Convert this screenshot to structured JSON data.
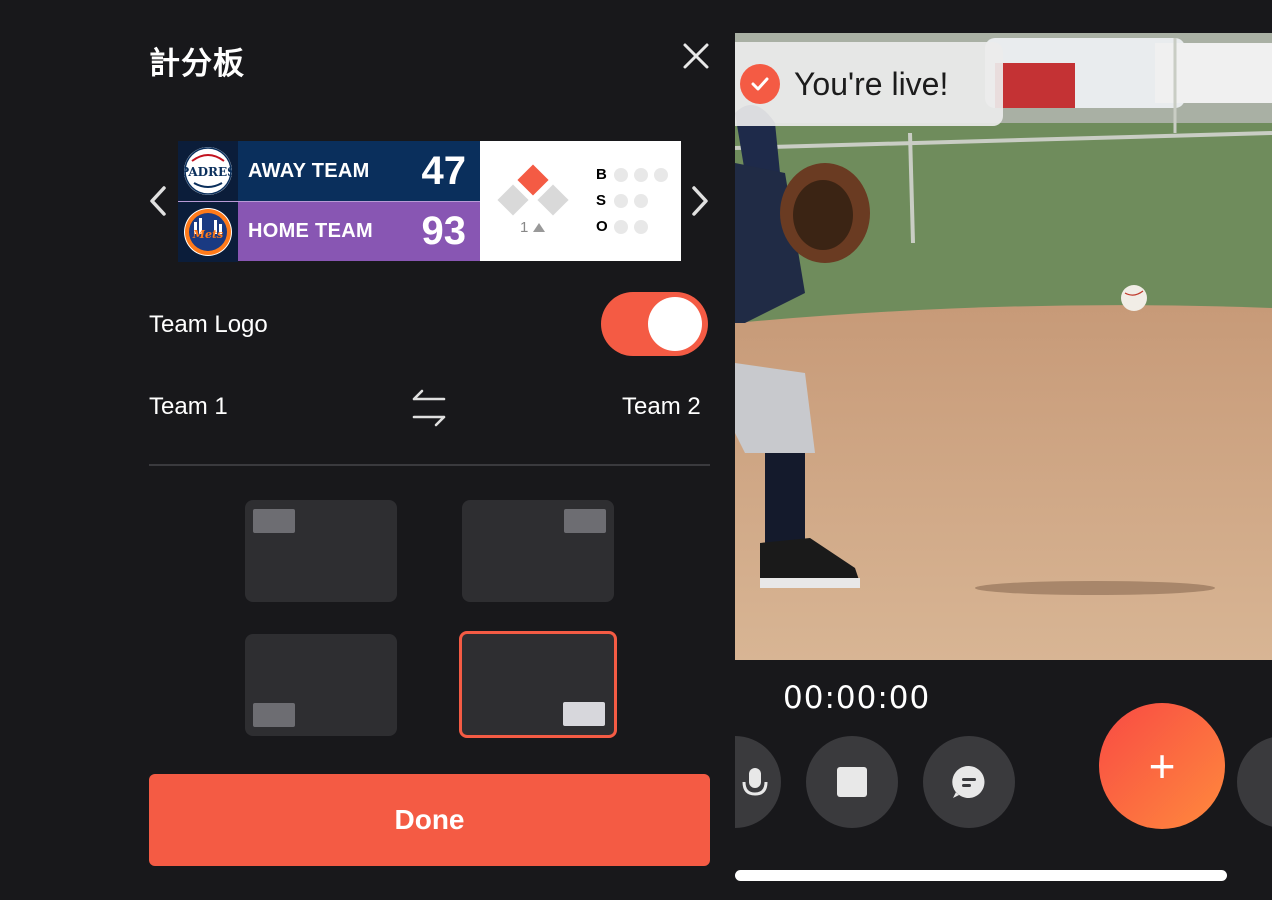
{
  "panel": {
    "title": "計分板",
    "close_icon": "close-icon"
  },
  "scoreboard": {
    "away": {
      "name": "AWAY TEAM",
      "score": "47",
      "logo_text": "PADRES",
      "logo_color": "#0a2f5c"
    },
    "home": {
      "name": "HOME TEAM",
      "score": "93",
      "logo_text": "Mets",
      "logo_color": "#ff7a1a"
    },
    "inning": "1",
    "inning_half_icon": "triangle-up-icon",
    "count_labels": {
      "balls": "B",
      "strikes": "S",
      "outs": "O"
    },
    "bases": {
      "first": false,
      "second": true,
      "third": false
    },
    "colors": {
      "away_bg": "#0a2f5c",
      "home_bg": "#8856b3",
      "accent": "#f45b44"
    }
  },
  "settings": {
    "team_logo_label": "Team Logo",
    "team_logo_enabled": true,
    "team1_label": "Team 1",
    "team2_label": "Team 2",
    "swap_icon": "swap-arrows-icon"
  },
  "positions": {
    "options": [
      "top-left",
      "top-right",
      "bottom-left",
      "bottom-right"
    ],
    "selected": "bottom-right"
  },
  "done_label": "Done",
  "live": {
    "banner_text": "You're live!",
    "timer": "00:00:00"
  },
  "controls": {
    "buttons": [
      "microphone-icon",
      "stop-icon",
      "chat-icon"
    ],
    "add_label": "+"
  },
  "colors": {
    "accent": "#f45b44",
    "background": "#18181b",
    "tile": "#2e2e31"
  }
}
